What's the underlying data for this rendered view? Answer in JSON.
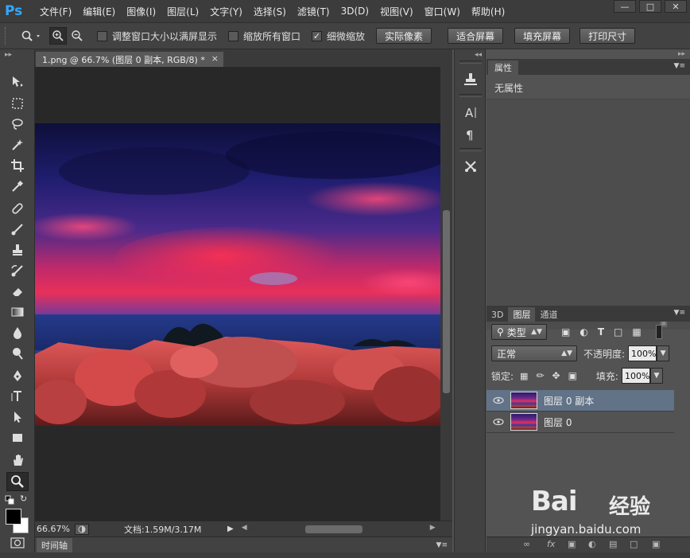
{
  "app": {
    "logo": "Ps",
    "menu": [
      "文件(F)",
      "编辑(E)",
      "图像(I)",
      "图层(L)",
      "文字(Y)",
      "选择(S)",
      "滤镜(T)",
      "3D(D)",
      "视图(V)",
      "窗口(W)",
      "帮助(H)"
    ],
    "window_controls": [
      "minimize-icon",
      "restore-icon",
      "close-icon"
    ]
  },
  "options": {
    "resize_windows": "调整窗口大小以满屏显示",
    "zoom_all": "缩放所有窗口",
    "scrubby_zoom": "细微缩放",
    "resize_windows_checked": false,
    "zoom_all_checked": false,
    "scrubby_zoom_checked": true,
    "buttons": [
      "实际像素",
      "适合屏幕",
      "填充屏幕",
      "打印尺寸"
    ]
  },
  "document": {
    "tab_title": "1.png @ 66.7% (图层 0 副本, RGB/8) *",
    "tab_close": "×"
  },
  "status": {
    "zoom": "66.67%",
    "doc_size": "文档:1.59M/3.17M"
  },
  "timeline": {
    "label": "时间轴"
  },
  "properties": {
    "tab": "属性",
    "empty": "无属性"
  },
  "layers": {
    "tabs": [
      "3D",
      "图层",
      "通道"
    ],
    "active_tab": 1,
    "filter_kind": "类型",
    "blend_mode": "正常",
    "opacity_label": "不透明度:",
    "opacity_value": "100%",
    "lock_label": "锁定:",
    "fill_label": "填充:",
    "fill_value": "100%",
    "items": [
      {
        "name": "图层 0 副本",
        "selected": true
      },
      {
        "name": "图层 0",
        "selected": false
      }
    ]
  },
  "watermark": {
    "brand": "Bai",
    "brand2": "经验",
    "url": "jingyan.baidu.com"
  },
  "colors": {
    "accent": "#31a8ff",
    "selected_layer": "#627388",
    "panel": "#535353",
    "dark": "#3c3c3c"
  }
}
